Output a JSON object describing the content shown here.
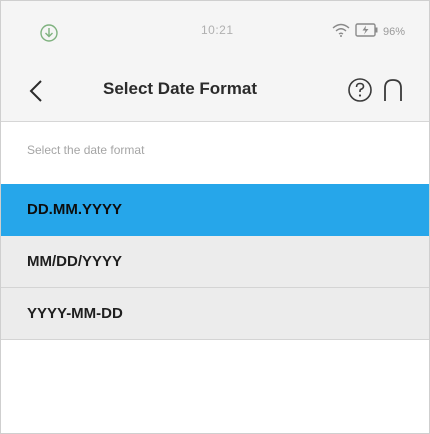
{
  "status_bar": {
    "time": "10:21",
    "battery": "96%",
    "left_icon": "download-circle-icon",
    "wifi_icon": "wifi-icon",
    "battery_icon": "battery-charging-icon"
  },
  "header": {
    "title": "Select Date Format",
    "back_icon": "chevron-left-icon",
    "help_icon": "help-circle-icon",
    "home_icon": "home-arch-icon"
  },
  "content": {
    "subtitle": "Select the date format",
    "options": [
      {
        "label": "DD.MM.YYYY",
        "selected": true
      },
      {
        "label": "MM/DD/YYYY",
        "selected": false
      },
      {
        "label": "YYYY-MM-DD",
        "selected": false
      }
    ]
  },
  "colors": {
    "accent": "#26a6ea",
    "row_background": "#ececec",
    "header_background": "#f5f5f5"
  }
}
